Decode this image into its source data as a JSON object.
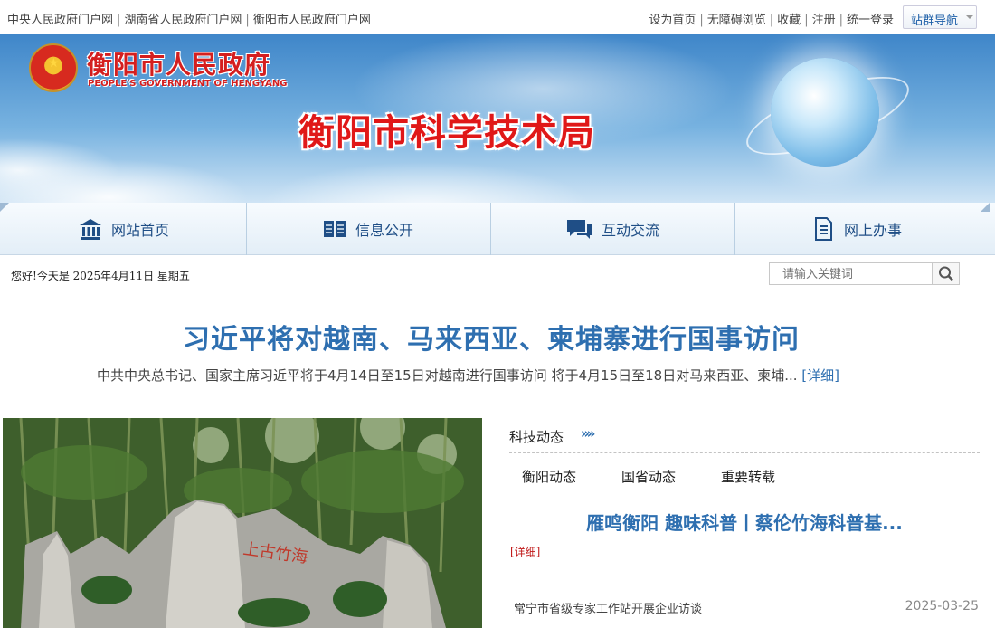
{
  "topbar": {
    "links": [
      "中央人民政府门户网",
      "湖南省人民政府门户网",
      "衡阳市人民政府门户网"
    ],
    "right_links": [
      "设为首页",
      "无障碍浏览",
      "收藏",
      "注册",
      "统一登录"
    ],
    "site_nav": "站群导航"
  },
  "banner": {
    "gov_name": "衡阳市人民政府",
    "gov_name_en": "PEOPLE'S GOVERNMENT OF HENGYANG",
    "bureau": "衡阳市科学技术局"
  },
  "nav": {
    "items": [
      {
        "label": "网站首页",
        "icon": "home-icon"
      },
      {
        "label": "信息公开",
        "icon": "book-icon"
      },
      {
        "label": "互动交流",
        "icon": "chat-icon"
      },
      {
        "label": "网上办事",
        "icon": "document-icon"
      }
    ]
  },
  "greeting": "您好!今天是 2025年4月11日  星期五",
  "search": {
    "placeholder": "请输入关键词"
  },
  "headline": {
    "title": "习近平将对越南、马来西亚、柬埔寨进行国事访问",
    "summary": "中共中央总书记、国家主席习近平将于4月14日至15日对越南进行国事访问   将于4月15日至18日对马来西亚、柬埔...",
    "more": "[详细]"
  },
  "photo": {
    "carving": "上古竹海"
  },
  "news": {
    "title": "科技动态",
    "tabs": [
      "衡阳动态",
      "国省动态",
      "重要转载"
    ],
    "featured": "雁鸣衡阳 趣味科普丨蔡伦竹海科普基...",
    "detail": "[详细]",
    "items": [
      {
        "title": "常宁市省级专家工作站开展企业访谈",
        "date": "2025-03-25"
      }
    ]
  },
  "colors": {
    "accent": "#2e6fb0",
    "banner_red": "#e01818",
    "detail_red": "#c01818"
  }
}
